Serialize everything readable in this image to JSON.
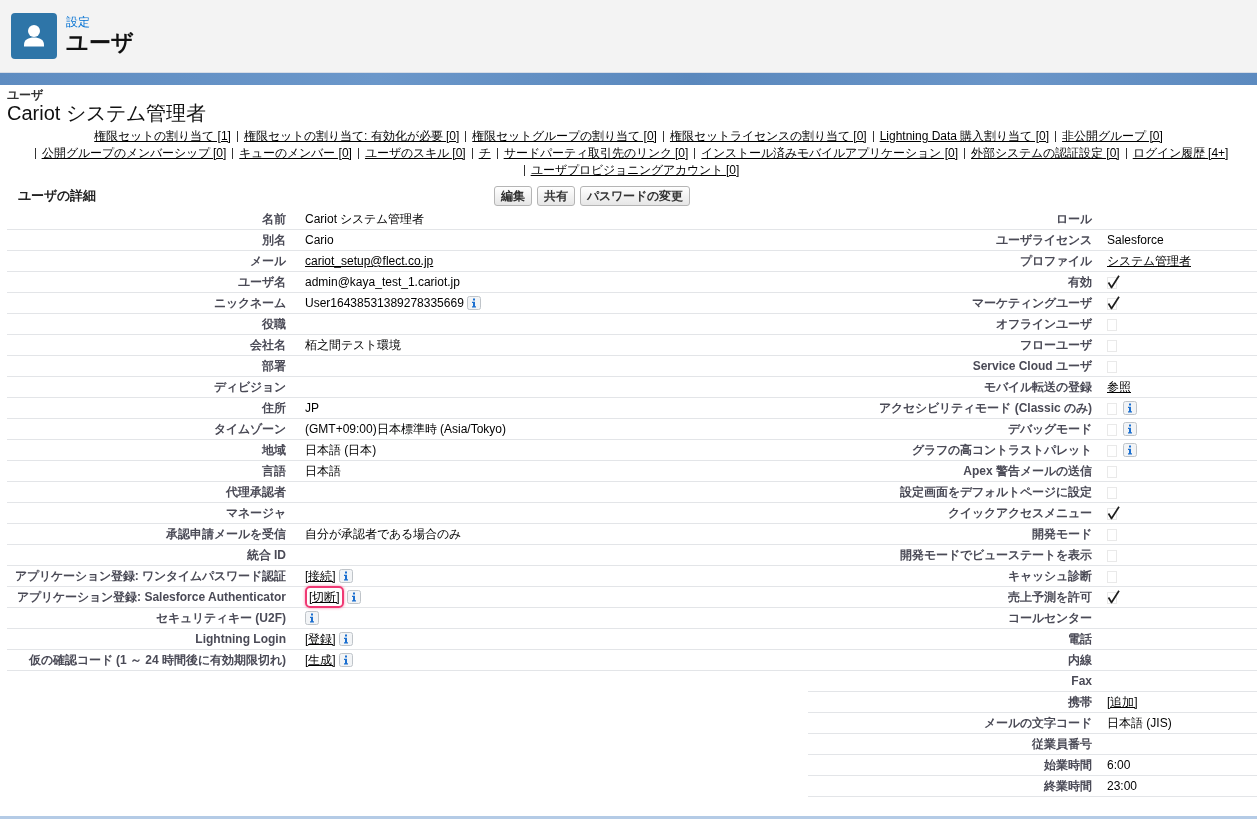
{
  "app_header": {
    "breadcrumb": "設定",
    "title": "ユーザ"
  },
  "record": {
    "object_label": "ユーザ",
    "name": "Cariot システム管理者"
  },
  "related_links": [
    "権限セットの割り当て [1]",
    "権限セットの割り当て: 有効化が必要 [0]",
    "権限セットグループの割り当て [0]",
    "権限セットライセンスの割り当て [0]",
    "Lightning Data 購入割り当て [0]",
    "非公開グループ [0]",
    "公開グループのメンバーシップ [0]",
    "キューのメンバー [0]",
    "ユーザのスキル [0]",
    "チ",
    "サードパーティ取引先のリンク [0]",
    "インストール済みモバイルアプリケーション [0]",
    "外部システムの認証設定 [0]",
    "ログイン履歴 [4+]",
    "ユーザプロビジョニングアカウント [0]"
  ],
  "detail": {
    "title": "ユーザの詳細",
    "buttons": [
      "編集",
      "共有",
      "パスワードの変更"
    ],
    "left_fields": [
      {
        "label": "名前",
        "kind": "text",
        "value": "Cariot システム管理者"
      },
      {
        "label": "別名",
        "kind": "text",
        "value": "Cario"
      },
      {
        "label": "メール",
        "kind": "link",
        "value": "cariot_setup@flect.co.jp"
      },
      {
        "label": "ユーザ名",
        "kind": "text",
        "value": "admin@kaya_test_1.cariot.jp"
      },
      {
        "label": "ニックネーム",
        "kind": "text",
        "value": "User16438531389278335669",
        "info": true
      },
      {
        "label": "役職",
        "kind": "blank"
      },
      {
        "label": "会社名",
        "kind": "text",
        "value": "栢之間テスト環境"
      },
      {
        "label": "部署",
        "kind": "blank"
      },
      {
        "label": "ディビジョン",
        "kind": "blank"
      },
      {
        "label": "住所",
        "kind": "text",
        "value": "JP"
      },
      {
        "label": "タイムゾーン",
        "kind": "text",
        "value": "(GMT+09:00)日本標準時 (Asia/Tokyo)"
      },
      {
        "label": "地域",
        "kind": "text",
        "value": "日本語 (日本)"
      },
      {
        "label": "言語",
        "kind": "text",
        "value": "日本語"
      },
      {
        "label": "代理承認者",
        "kind": "blank"
      },
      {
        "label": "マネージャ",
        "kind": "blank"
      },
      {
        "label": "承認申請メールを受信",
        "kind": "text",
        "value": "自分が承認者である場合のみ"
      },
      {
        "label": "統合 ID",
        "kind": "blank"
      },
      {
        "label": "アプリケーション登録: ワンタイムパスワード認証",
        "kind": "link",
        "value": "[接続]",
        "info": true
      },
      {
        "label": "アプリケーション登録: Salesforce Authenticator",
        "kind": "link",
        "value": "[切断]",
        "info": true,
        "highlighted": true
      },
      {
        "label": "セキュリティキー (U2F)",
        "kind": "blank",
        "info": true
      },
      {
        "label": "Lightning Login",
        "kind": "link",
        "value": "[登録]",
        "info": true
      },
      {
        "label": "仮の確認コード (1 ～ 24 時間後に有効期限切れ)",
        "kind": "link",
        "value": "[生成]",
        "info": true
      }
    ],
    "right_fields": [
      {
        "label": "ロール",
        "kind": "blank"
      },
      {
        "label": "ユーザライセンス",
        "kind": "text",
        "value": "Salesforce"
      },
      {
        "label": "プロファイル",
        "kind": "link",
        "value": "システム管理者"
      },
      {
        "label": "有効",
        "kind": "checkbox",
        "checked": true
      },
      {
        "label": "マーケティングユーザ",
        "kind": "checkbox",
        "checked": true
      },
      {
        "label": "オフラインユーザ",
        "kind": "checkbox",
        "checked": false
      },
      {
        "label": "フローユーザ",
        "kind": "checkbox",
        "checked": false
      },
      {
        "label": "Service Cloud ユーザ",
        "kind": "checkbox",
        "checked": false
      },
      {
        "label": "モバイル転送の登録",
        "kind": "link",
        "value": "参照"
      },
      {
        "label": "アクセシビリティモード (Classic のみ)",
        "kind": "checkbox",
        "checked": false,
        "info": true
      },
      {
        "label": "デバッグモード",
        "kind": "checkbox",
        "checked": false,
        "info": true
      },
      {
        "label": "グラフの高コントラストパレット",
        "kind": "checkbox",
        "checked": false,
        "info": true
      },
      {
        "label": "Apex 警告メールの送信",
        "kind": "checkbox",
        "checked": false
      },
      {
        "label": "設定画面をデフォルトページに設定",
        "kind": "checkbox",
        "checked": false
      },
      {
        "label": "クイックアクセスメニュー",
        "kind": "checkbox",
        "checked": true
      },
      {
        "label": "開発モード",
        "kind": "checkbox",
        "checked": false
      },
      {
        "label": "開発モードでビューステートを表示",
        "kind": "checkbox",
        "checked": false
      },
      {
        "label": "キャッシュ診断",
        "kind": "checkbox",
        "checked": false
      },
      {
        "label": "売上予測を許可",
        "kind": "checkbox",
        "checked": true
      },
      {
        "label": "コールセンター",
        "kind": "blank"
      },
      {
        "label": "電話",
        "kind": "blank"
      },
      {
        "label": "内線",
        "kind": "blank"
      },
      {
        "label": "Fax",
        "kind": "blank"
      },
      {
        "label": "携帯",
        "kind": "link",
        "value": "[追加]"
      },
      {
        "label": "メールの文字コード",
        "kind": "text",
        "value": "日本語 (JIS)"
      },
      {
        "label": "従業員番号",
        "kind": "blank"
      },
      {
        "label": "始業時間",
        "kind": "text",
        "value": "6:00"
      },
      {
        "label": "終業時間",
        "kind": "text",
        "value": "23:00"
      }
    ]
  }
}
